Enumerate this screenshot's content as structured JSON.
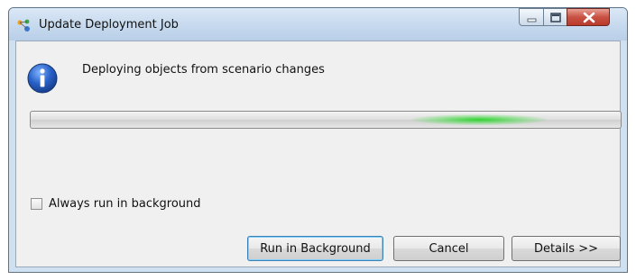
{
  "window": {
    "title": "Update Deployment Job"
  },
  "dialog": {
    "message": "Deploying objects from scenario changes",
    "icon": "info-icon",
    "progress": {
      "mode": "indeterminate",
      "glow_position": 0.76,
      "color": "#2ed12e"
    },
    "checkbox": {
      "label": "Always run in background",
      "checked": false
    },
    "buttons": {
      "run_in_background": "Run in Background",
      "cancel": "Cancel",
      "details": "Details >>"
    }
  },
  "colors": {
    "titlebar": "#c6d9ee",
    "close_button": "#c95143",
    "client_background": "#f0f0f0"
  }
}
